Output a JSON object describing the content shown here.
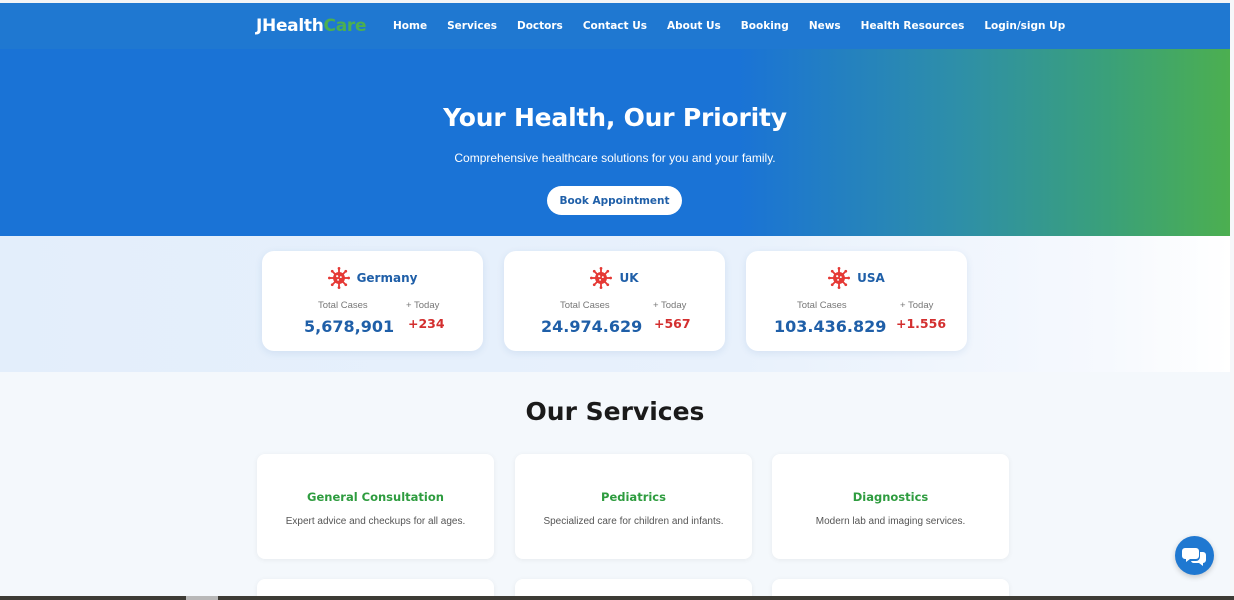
{
  "brand": {
    "part1": "JHealth",
    "part2": "Care"
  },
  "nav": {
    "items": [
      {
        "label": "Home"
      },
      {
        "label": "Services"
      },
      {
        "label": "Doctors"
      },
      {
        "label": "Contact Us"
      },
      {
        "label": "About Us"
      },
      {
        "label": "Booking"
      },
      {
        "label": "News"
      },
      {
        "label": "Health Resources"
      },
      {
        "label": "Login/sign Up"
      }
    ]
  },
  "hero": {
    "title": "Your Health, Our Priority",
    "subtitle": "Comprehensive healthcare solutions for you and your family.",
    "button_label": "Book Appointment"
  },
  "stats": {
    "total_label": "Total Cases",
    "today_label": "+ Today",
    "cards": [
      {
        "country": "Germany",
        "total": "5,678,901",
        "today": "+234",
        "icon": "virus-icon"
      },
      {
        "country": "UK",
        "total": "24.974.629",
        "today": "+567",
        "icon": "virus-icon"
      },
      {
        "country": "USA",
        "total": "103.436.829",
        "today": "+1.556",
        "icon": "virus-icon"
      }
    ]
  },
  "services": {
    "title": "Our Services",
    "items": [
      {
        "title": "General Consultation",
        "description": "Expert advice and checkups for all ages."
      },
      {
        "title": "Pediatrics",
        "description": "Specialized care for children and infants."
      },
      {
        "title": "Diagnostics",
        "description": "Modern lab and imaging services."
      }
    ]
  },
  "chat": {
    "icon": "chat-bubbles-icon"
  },
  "colors": {
    "primary": "#1f78d1",
    "accent_green": "#4caf50",
    "stat_blue": "#1f5fa8",
    "stat_red": "#d32f2f",
    "service_green": "#2e9c3f"
  }
}
